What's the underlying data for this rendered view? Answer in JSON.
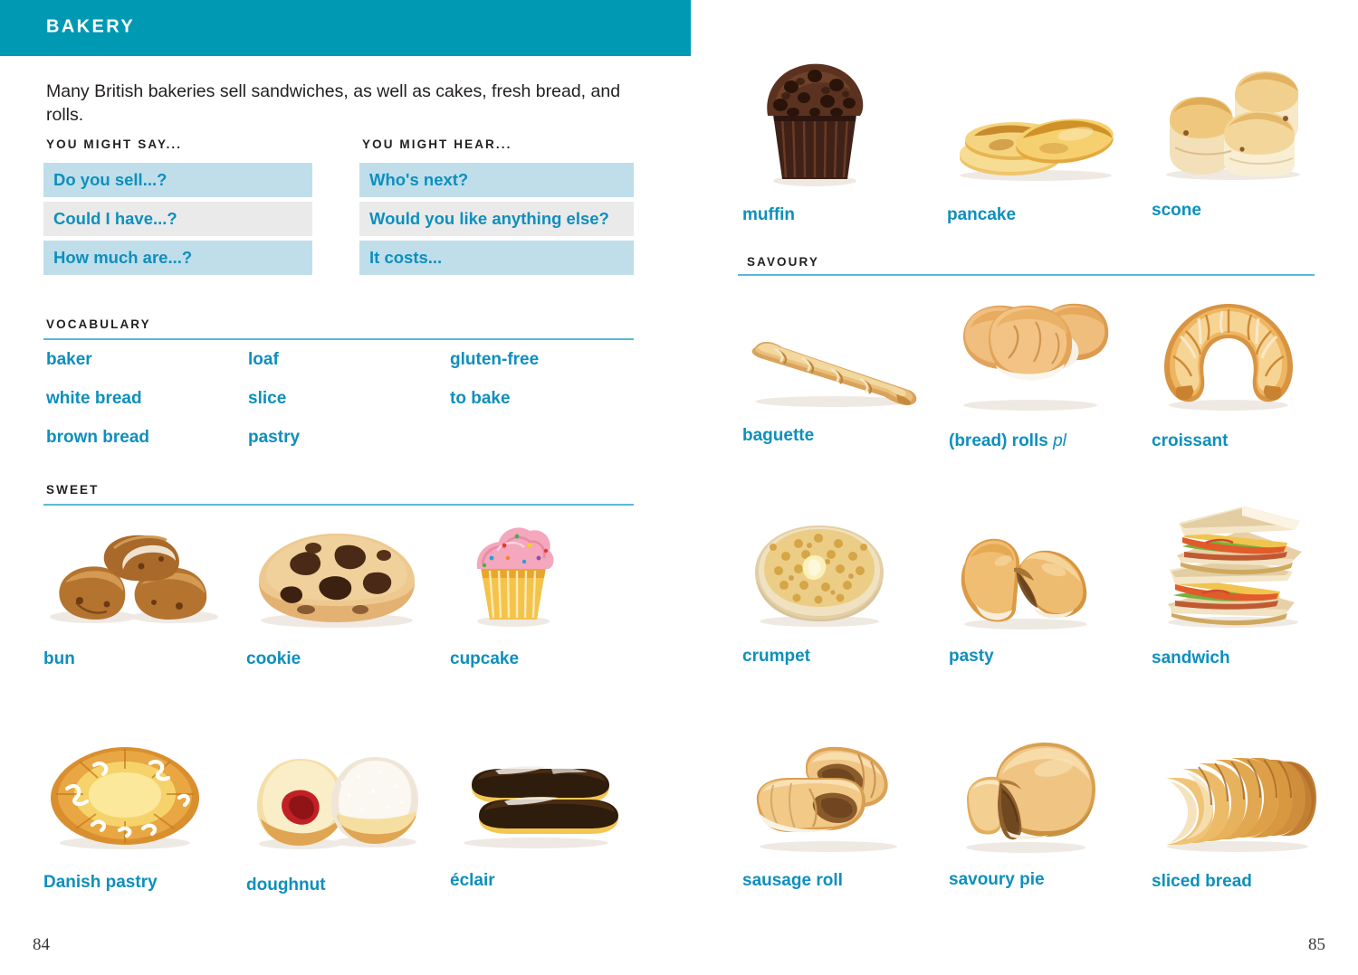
{
  "colors": {
    "header_band": "#0099b4",
    "accent_blue": "#0e8fbd",
    "rule": "#5ab9d6",
    "tint_box": "#bfdeea",
    "plain_box": "#eaeaea",
    "body_text": "#231f20"
  },
  "header": {
    "title": "BAKERY"
  },
  "intro": {
    "text": "Many British bakeries sell sandwiches, as well as cakes, fresh bread, and rolls."
  },
  "phrases": {
    "say": {
      "heading": "YOU MIGHT SAY...",
      "items": [
        {
          "text": "Do you sell...?",
          "style": "tint"
        },
        {
          "text": "Could I have...?",
          "style": "plain"
        },
        {
          "text": "How much are...?",
          "style": "tint"
        }
      ]
    },
    "hear": {
      "heading": "YOU MIGHT HEAR...",
      "items": [
        {
          "text": "Who's next?",
          "style": "tint"
        },
        {
          "text": "Would you like anything else?",
          "style": "plain"
        },
        {
          "text": "It costs...",
          "style": "tint"
        }
      ]
    }
  },
  "vocabulary": {
    "heading": "VOCABULARY",
    "columns": [
      [
        "baker",
        "white bread",
        "brown bread"
      ],
      [
        "loaf",
        "slice",
        "pastry"
      ],
      [
        "gluten-free",
        "to bake",
        ""
      ]
    ]
  },
  "sweet": {
    "heading": "SWEET",
    "items": [
      {
        "label": "bun",
        "icon": "bun-photo"
      },
      {
        "label": "cookie",
        "icon": "cookie-photo"
      },
      {
        "label": "cupcake",
        "icon": "cupcake-photo"
      },
      {
        "label": "Danish pastry",
        "icon": "danish-pastry-photo"
      },
      {
        "label": "doughnut",
        "icon": "doughnut-photo"
      },
      {
        "label": "éclair",
        "icon": "eclair-photo"
      }
    ]
  },
  "top_right": {
    "items": [
      {
        "label": "muffin",
        "icon": "muffin-photo"
      },
      {
        "label": "pancake",
        "icon": "pancake-photo"
      },
      {
        "label": "scone",
        "icon": "scone-photo"
      }
    ]
  },
  "savoury": {
    "heading": "SAVOURY",
    "items": [
      {
        "label": "baguette",
        "suffix": "",
        "icon": "baguette-photo"
      },
      {
        "label": "(bread) rolls",
        "suffix": "pl",
        "icon": "bread-rolls-photo"
      },
      {
        "label": "croissant",
        "suffix": "",
        "icon": "croissant-photo"
      },
      {
        "label": "crumpet",
        "suffix": "",
        "icon": "crumpet-photo"
      },
      {
        "label": "pasty",
        "suffix": "",
        "icon": "pasty-photo"
      },
      {
        "label": "sandwich",
        "suffix": "",
        "icon": "sandwich-photo"
      },
      {
        "label": "sausage roll",
        "suffix": "",
        "icon": "sausage-roll-photo"
      },
      {
        "label": "savoury pie",
        "suffix": "",
        "icon": "savoury-pie-photo"
      },
      {
        "label": "sliced bread",
        "suffix": "",
        "icon": "sliced-bread-photo"
      }
    ]
  },
  "folios": {
    "left": "84",
    "right": "85"
  }
}
